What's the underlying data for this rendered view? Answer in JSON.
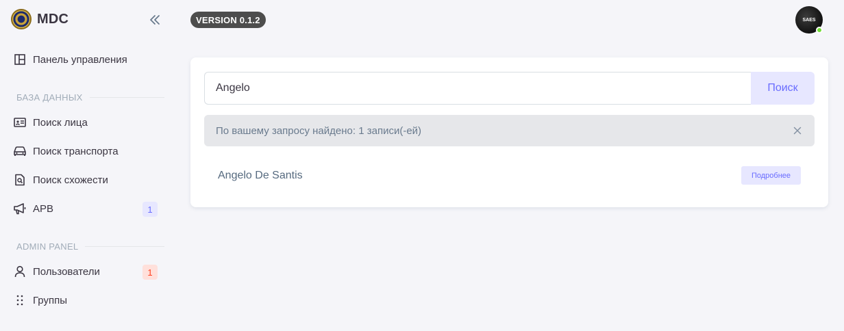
{
  "brand": {
    "name": "MDC",
    "logo_icon": "seal-icon"
  },
  "sidebar": {
    "dashboard": {
      "label": "Панель управления",
      "icon": "layout-icon"
    },
    "section_db": "БАЗА ДАННЫХ",
    "db_items": [
      {
        "label": "Поиск лица",
        "icon": "id-card-icon"
      },
      {
        "label": "Поиск транспорта",
        "icon": "car-icon"
      },
      {
        "label": "Поиск схожести",
        "icon": "file-search-icon"
      },
      {
        "label": "APB",
        "icon": "megaphone-icon",
        "badge": "1"
      }
    ],
    "section_admin": "ADMIN PANEL",
    "admin_items": [
      {
        "label": "Пользователи",
        "icon": "user-icon",
        "badge": "1"
      },
      {
        "label": "Группы",
        "icon": "dots-grid-icon"
      }
    ]
  },
  "header": {
    "version": "VERSION 0.1.2",
    "avatar_text": "SAES",
    "status_color": "#71dd37"
  },
  "search": {
    "value": "Angelo",
    "button_label": "Поиск"
  },
  "alert": {
    "text": "По вашему запросу найдено: 1 записи(-ей)"
  },
  "results": [
    {
      "name": "Angelo De Santis",
      "button_label": "Подробнее"
    }
  ],
  "colors": {
    "accent": "#696cff",
    "accent_bg": "#e7e7ff",
    "danger": "#ff3e1d",
    "bg": "#f5f5f9"
  }
}
